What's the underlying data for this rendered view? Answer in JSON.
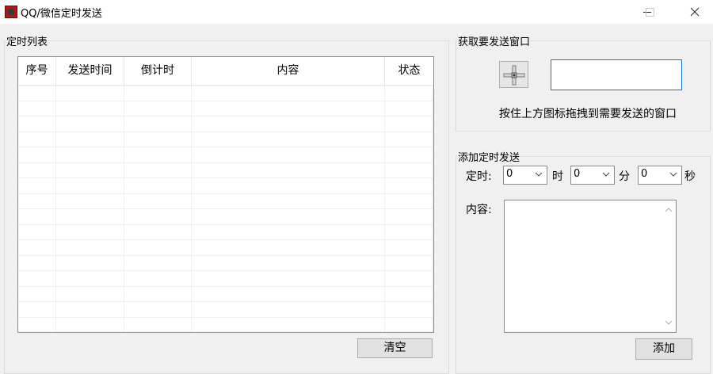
{
  "window": {
    "title": "QQ/微信定时发送",
    "controls": {
      "minimize": "—",
      "maximize": "□",
      "close": "✕"
    }
  },
  "schedule_list": {
    "legend": "定时列表",
    "columns": [
      "序号",
      "发送时间",
      "倒计时",
      "内容",
      "状态"
    ],
    "rows": [],
    "clear_button": "清空"
  },
  "capture_window": {
    "legend": "获取要发送窗口",
    "crosshair_icon": "crosshair-drag-icon",
    "window_field_value": "",
    "hint": "按住上方图标拖拽到需要发送的窗口"
  },
  "add_schedule": {
    "legend": "添加定时发送",
    "time_label": "定时:",
    "hour": {
      "value": "0",
      "unit": "时"
    },
    "minute": {
      "value": "0",
      "unit": "分"
    },
    "second": {
      "value": "0",
      "unit": "秒"
    },
    "content_label": "内容:",
    "content_value": "",
    "add_button": "添加"
  },
  "colors": {
    "window_bg": "#f0f0f0",
    "focus_border": "#1a73d2",
    "app_icon": "#b01818"
  }
}
